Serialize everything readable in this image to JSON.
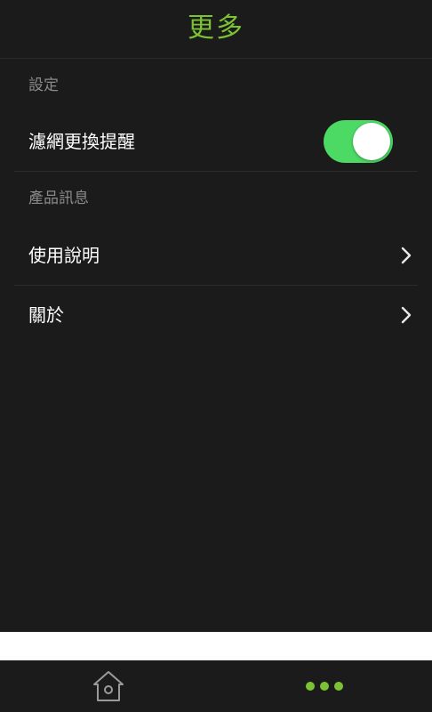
{
  "header": {
    "title": "更多"
  },
  "sections": {
    "settings": {
      "label": "設定",
      "filter_reminder": {
        "label": "濾網更換提醒",
        "enabled": true
      }
    },
    "product_info": {
      "label": "產品訊息",
      "items": [
        {
          "label": "使用說明"
        },
        {
          "label": "關於"
        }
      ]
    }
  },
  "tabbar": {
    "tabs": [
      {
        "icon": "home-icon",
        "active": false
      },
      {
        "icon": "more-dots-icon",
        "active": true
      }
    ]
  },
  "colors": {
    "accent": "#7cc334",
    "toggle_on": "#4cd964",
    "background": "#1b1b1b",
    "section_label": "#8a8a8a"
  }
}
